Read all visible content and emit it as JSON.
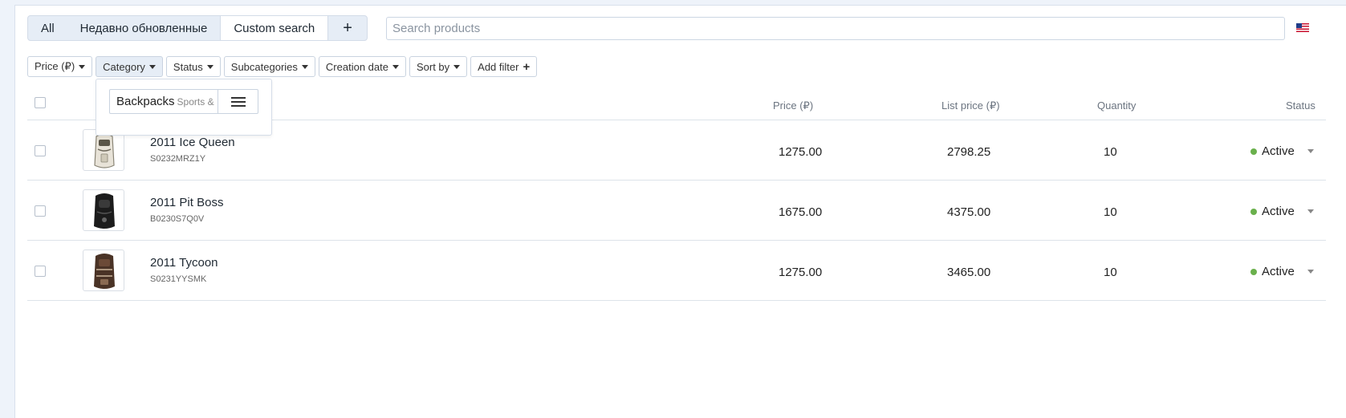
{
  "tabs": [
    {
      "label": "All"
    },
    {
      "label": "Недавно обновленные"
    },
    {
      "label": "Custom search"
    },
    {
      "label": "+"
    }
  ],
  "search": {
    "placeholder": "Search products"
  },
  "language_flag": "us-flag-icon",
  "filters": [
    {
      "label": "Price (₽)"
    },
    {
      "label": "Category"
    },
    {
      "label": "Status"
    },
    {
      "label": "Subcategories"
    },
    {
      "label": "Creation date"
    },
    {
      "label": "Sort by"
    },
    {
      "label": "Add filter"
    }
  ],
  "category_dropdown": {
    "value": "Backpacks",
    "sub": "Sports &"
  },
  "table": {
    "headers": {
      "price": "Price (₽)",
      "list_price": "List price (₽)",
      "quantity": "Quantity",
      "status": "Status"
    },
    "rows": [
      {
        "name": "2011 Ice Queen",
        "code": "S0232MRZ1Y",
        "price": "1275.00",
        "list_price": "2798.25",
        "quantity": "10",
        "status": "Active"
      },
      {
        "name": "2011 Pit Boss",
        "code": "B0230S7Q0V",
        "price": "1675.00",
        "list_price": "4375.00",
        "quantity": "10",
        "status": "Active"
      },
      {
        "name": "2011 Tycoon",
        "code": "S0231YYSMK",
        "price": "1275.00",
        "list_price": "3465.00",
        "quantity": "10",
        "status": "Active"
      }
    ]
  },
  "colors": {
    "active_status": "#6ab04c",
    "background": "#eef3fa"
  }
}
